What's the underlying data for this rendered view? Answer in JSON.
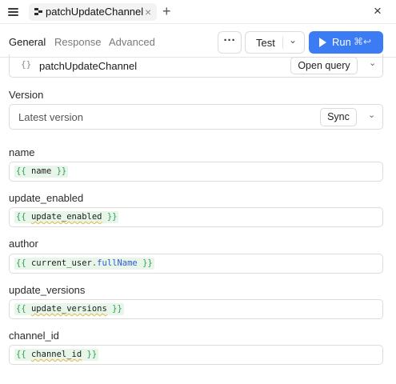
{
  "tab": {
    "title": "patchUpdateChannel",
    "close": "×"
  },
  "header": {
    "add_tab": "+",
    "close_panel": "×"
  },
  "subtabs": {
    "general": "General",
    "response": "Response",
    "advanced": "Advanced"
  },
  "toolbar": {
    "more": "···",
    "environment": "Test",
    "run_label": "Run",
    "run_shortcut": "⌘↩"
  },
  "resource": {
    "icon_text": "{}",
    "name": "patchUpdateChannel",
    "open_query": "Open query"
  },
  "version": {
    "label": "Version",
    "value": "Latest version",
    "sync": "Sync"
  },
  "fields": {
    "name": {
      "label": "name",
      "var": "name"
    },
    "update_enabled": {
      "label": "update_enabled",
      "var": "update_enabled"
    },
    "author": {
      "label": "author",
      "var": "current_user",
      "prop": "fullName"
    },
    "update_versions": {
      "label": "update_versions",
      "var": "update_versions"
    },
    "channel_id": {
      "label": "channel_id",
      "var": "channel_id"
    }
  },
  "code_tokens": {
    "open": "{{",
    "close": "}}",
    "dot": "."
  },
  "colors": {
    "accent": "#3b7cf4",
    "brace": "#2f9e57",
    "prop": "#2f5bd1",
    "code_bg": "#e8f6ea"
  }
}
